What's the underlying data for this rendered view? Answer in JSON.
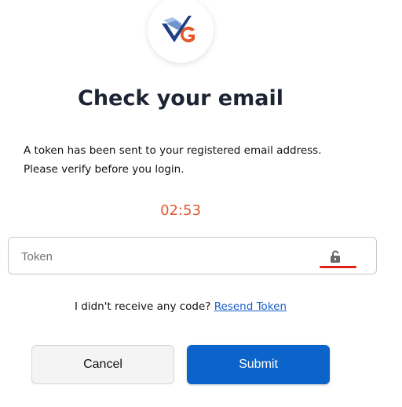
{
  "logo": {
    "icon": "brand-logo-icon"
  },
  "heading": "Check your email",
  "message": {
    "line1": "A token has been sent to your registered email address.",
    "line2": "Please verify before you login."
  },
  "timer": "02:53",
  "token_field": {
    "placeholder": "Token",
    "value": "",
    "icon": "unlock-icon"
  },
  "resend": {
    "prompt": "I didn't receive any code?",
    "link_label": "Resend Token"
  },
  "buttons": {
    "cancel_label": "Cancel",
    "submit_label": "Submit"
  },
  "colors": {
    "timer": "#e4572e",
    "submit": "#0c63c9",
    "link": "#1a5fc8",
    "underline": "#e0201b"
  }
}
